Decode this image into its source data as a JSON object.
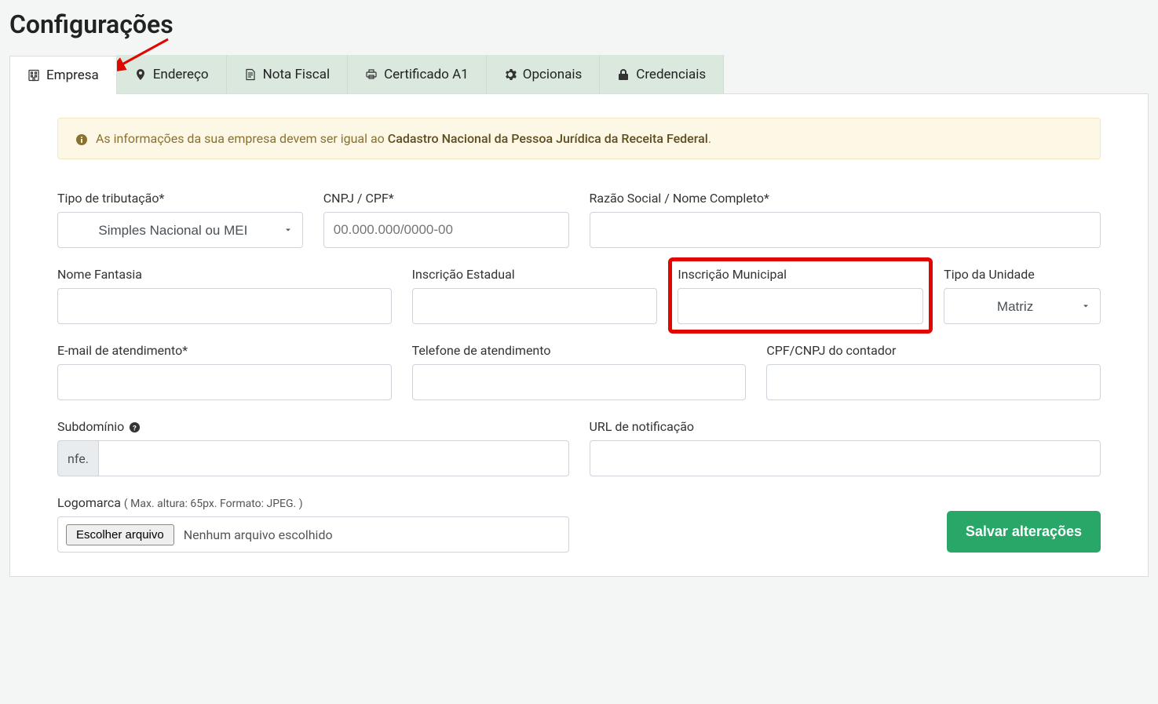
{
  "page": {
    "title": "Configurações"
  },
  "tabs": {
    "empresa": "Empresa",
    "endereco": "Endereço",
    "nota_fiscal": "Nota Fiscal",
    "certificado": "Certificado A1",
    "opcionais": "Opcionais",
    "credenciais": "Credenciais"
  },
  "banner": {
    "prefix": "As informações da sua empresa devem ser igual ao ",
    "highlight": "Cadastro Nacional da Pessoa Jurídica da Receita Federal",
    "suffix": "."
  },
  "labels": {
    "tipo_tributacao": "Tipo de tributação*",
    "cnpj_cpf": "CNPJ / CPF*",
    "razao_social": "Razão Social / Nome Completo*",
    "nome_fantasia": "Nome Fantasia",
    "inscricao_estadual": "Inscrição Estadual",
    "inscricao_municipal": "Inscrição Municipal",
    "tipo_unidade": "Tipo da Unidade",
    "email_atendimento": "E-mail de atendimento*",
    "telefone": "Telefone de atendimento",
    "cpf_cnpj_contador": "CPF/CNPJ do contador",
    "subdominio": "Subdomínio",
    "url_notificacao": "URL de notificação",
    "logomarca": "Logomarca",
    "logomarca_hint": "( Max. altura: 65px. Formato: JPEG. )"
  },
  "fields": {
    "tipo_tributacao_value": "Simples Nacional ou MEI",
    "cnpj_placeholder": "00.000.000/0000-00",
    "tipo_unidade_value": "Matriz",
    "subdominio_prefix": "nfe.",
    "file_button": "Escolher arquivo",
    "file_empty": "Nenhum arquivo escolhido"
  },
  "buttons": {
    "save": "Salvar alterações"
  }
}
